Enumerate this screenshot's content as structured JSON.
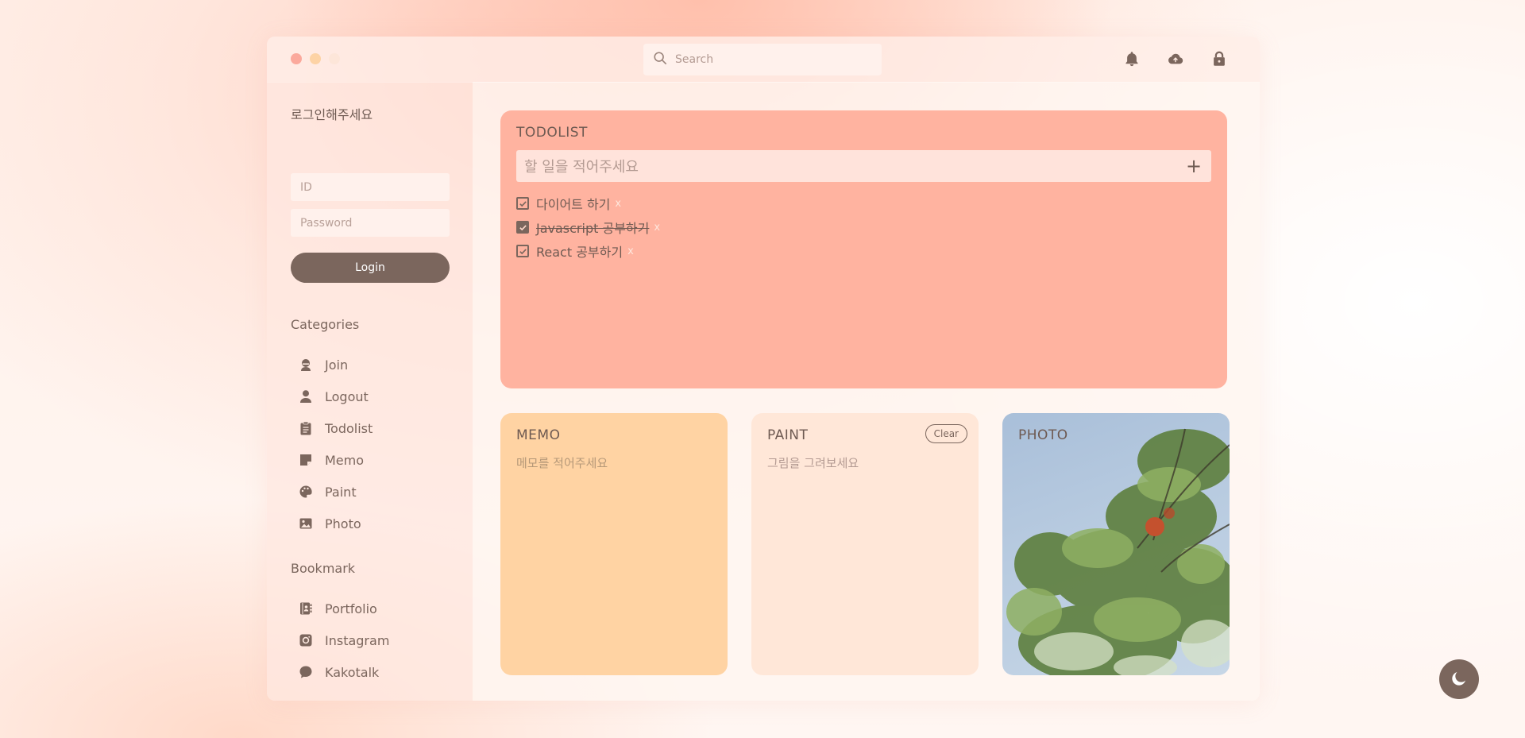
{
  "search": {
    "placeholder": "Search"
  },
  "sidebar": {
    "login_title": "로그인해주세요",
    "id_placeholder": "ID",
    "password_placeholder": "Password",
    "login_label": "Login",
    "categories_title": "Categories",
    "categories": [
      {
        "label": "Join",
        "icon": "user-secret-icon"
      },
      {
        "label": "Logout",
        "icon": "user-icon"
      },
      {
        "label": "Todolist",
        "icon": "clipboard-icon"
      },
      {
        "label": "Memo",
        "icon": "sticky-note-icon"
      },
      {
        "label": "Paint",
        "icon": "palette-icon"
      },
      {
        "label": "Photo",
        "icon": "image-icon"
      }
    ],
    "bookmark_title": "Bookmark",
    "bookmarks": [
      {
        "label": "Portfolio",
        "icon": "address-book-icon"
      },
      {
        "label": "Instagram",
        "icon": "instagram-icon"
      },
      {
        "label": "Kakotalk",
        "icon": "chat-bubble-icon"
      }
    ]
  },
  "header_icons": [
    "bell-icon",
    "cloud-icon",
    "lock-icon"
  ],
  "todo": {
    "title": "TODOLIST",
    "input_placeholder": "할 일을 적어주세요",
    "add_label": "+",
    "items": [
      {
        "text": "다이어트 하기",
        "done": false,
        "delete_label": "x"
      },
      {
        "text": "Javascript 공부하기",
        "done": true,
        "delete_label": "x"
      },
      {
        "text": "React 공부하기",
        "done": false,
        "delete_label": "x"
      }
    ]
  },
  "memo": {
    "title": "MEMO",
    "placeholder": "메모를 적어주세요"
  },
  "paint": {
    "title": "PAINT",
    "clear_label": "Clear",
    "hint": "그림을 그려보세요"
  },
  "photo": {
    "title": "PHOTO"
  },
  "theme_toggle": {
    "icon": "moon-icon"
  },
  "colors": {
    "accent": "#7b665d",
    "todo_card": "#ffb3a0",
    "memo_card": "#ffd3a3",
    "paint_card": "#ffe7d8"
  }
}
